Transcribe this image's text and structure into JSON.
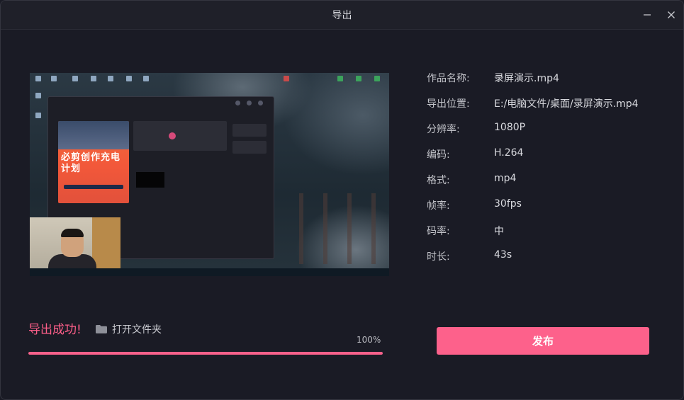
{
  "window": {
    "title": "导出"
  },
  "info": {
    "rows": [
      {
        "label": "作品名称:",
        "value": "录屏演示.mp4"
      },
      {
        "label": "导出位置:",
        "value": "E:/电脑文件/桌面/录屏演示.mp4"
      },
      {
        "label": "分辨率:",
        "value": "1080P"
      },
      {
        "label": "编码:",
        "value": "H.264"
      },
      {
        "label": "格式:",
        "value": "mp4"
      },
      {
        "label": "帧率:",
        "value": "30fps"
      },
      {
        "label": "码率:",
        "value": "中"
      },
      {
        "label": "时长:",
        "value": "43s"
      }
    ]
  },
  "preview": {
    "banner_text": "必剪创作充电计划"
  },
  "status": {
    "message": "导出成功!",
    "open_folder_label": "打开文件夹",
    "progress_text": "100%",
    "progress_value": 1.0
  },
  "actions": {
    "publish_label": "发布"
  },
  "colors": {
    "accent": "#fd618b",
    "success_text": "#ff5f8a",
    "background": "#1a1b25"
  }
}
